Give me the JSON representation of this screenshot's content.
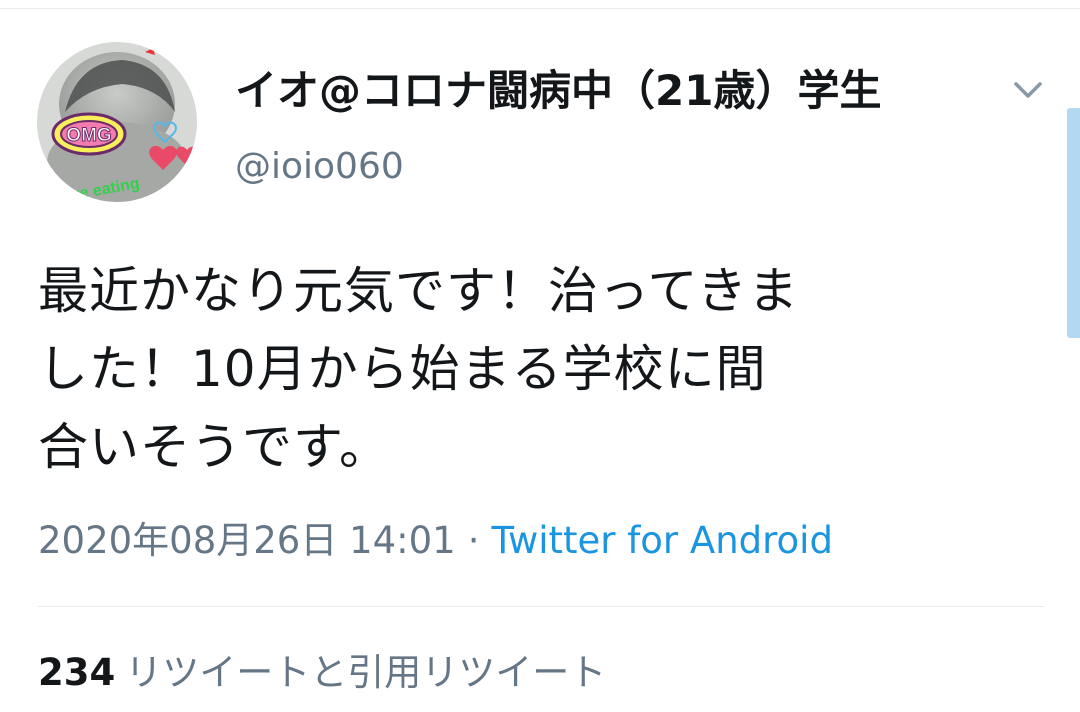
{
  "tweet": {
    "author": {
      "display_name": "イオ@コロナ闘病中（21歳）学生",
      "handle": "@ioio060",
      "avatar": {
        "badge_text": "OMG",
        "caption_text": "love eating",
        "icon": "avatar-photo"
      }
    },
    "text": "最近かなり元気です！治ってきま\nした！10月から始まる学校に間\n合いそうです。",
    "timestamp": "2020年08月26日 14:01",
    "separator": "·",
    "source": "Twitter for Android",
    "retweet_count": "234",
    "retweet_label": "リツイートと引用リツイート"
  },
  "icons": {
    "more": "chevron-down-icon"
  },
  "colors": {
    "text_primary": "#14171a",
    "text_secondary": "#657786",
    "link": "#1b95e0",
    "divider": "#e6ecf0"
  }
}
